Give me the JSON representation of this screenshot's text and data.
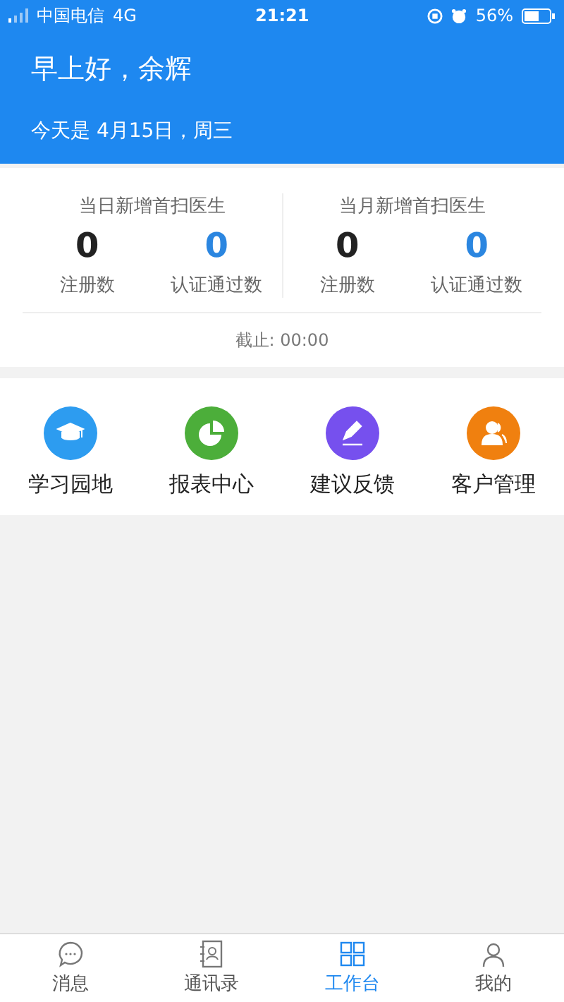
{
  "status_bar": {
    "carrier": "中国电信",
    "network": "4G",
    "time": "21:21",
    "battery": "56%"
  },
  "header": {
    "greeting": "早上好，余辉",
    "date": "今天是 4月15日，周三"
  },
  "stats": {
    "groups": [
      {
        "title": "当日新增首扫医生",
        "metrics": [
          {
            "value": "0",
            "label": "注册数",
            "color": "#222222"
          },
          {
            "value": "0",
            "label": "认证通过数",
            "color": "#2b86e0"
          }
        ]
      },
      {
        "title": "当月新增首扫医生",
        "metrics": [
          {
            "value": "0",
            "label": "注册数",
            "color": "#222222"
          },
          {
            "value": "0",
            "label": "认证通过数",
            "color": "#2b86e0"
          }
        ]
      }
    ],
    "footer": "截止: 00:00"
  },
  "shortcuts": [
    {
      "label": "学习园地",
      "kind": "cap",
      "color": "#2d9cf0"
    },
    {
      "label": "报表中心",
      "kind": "chart",
      "color": "#4cae3a"
    },
    {
      "label": "建议反馈",
      "kind": "pen",
      "color": "#7650ee"
    },
    {
      "label": "客户管理",
      "kind": "person",
      "color": "#f0800f"
    }
  ],
  "tabs": [
    {
      "label": "消息",
      "kind": "chat",
      "selected": false
    },
    {
      "label": "通讯录",
      "kind": "contacts",
      "selected": false
    },
    {
      "label": "工作台",
      "kind": "desk",
      "selected": true
    },
    {
      "label": "我的",
      "kind": "me",
      "selected": false
    }
  ]
}
